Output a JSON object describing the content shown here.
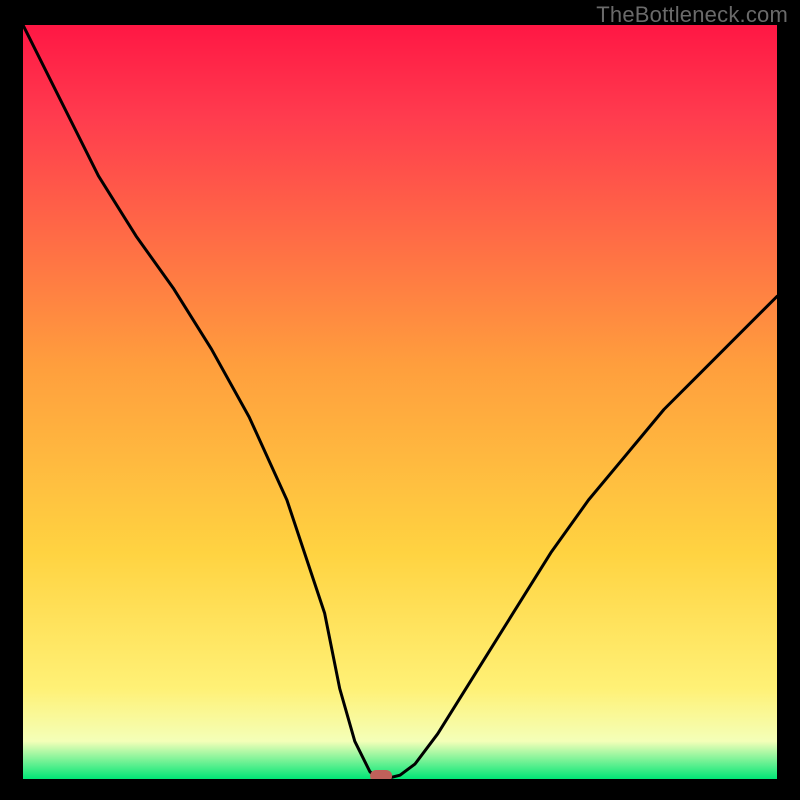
{
  "attribution": "TheBottleneck.com",
  "chart_data": {
    "type": "line",
    "title": "",
    "xlabel": "",
    "ylabel": "",
    "xlim": [
      0,
      100
    ],
    "ylim": [
      0,
      100
    ],
    "curve": {
      "x": [
        0,
        5,
        10,
        15,
        20,
        25,
        30,
        35,
        40,
        42,
        44,
        46,
        47,
        48,
        50,
        52,
        55,
        60,
        65,
        70,
        75,
        80,
        85,
        90,
        95,
        100
      ],
      "y": [
        100,
        90,
        80,
        72,
        65,
        57,
        48,
        37,
        22,
        12,
        5,
        1,
        0,
        0,
        0.5,
        2,
        6,
        14,
        22,
        30,
        37,
        43,
        49,
        54,
        59,
        64
      ]
    },
    "marker": {
      "x": 47.5,
      "y": 0
    },
    "gradient": {
      "top": "#ff1744",
      "mid": "#ffd600",
      "low": "#ffff8d",
      "base": "#00e676"
    }
  }
}
